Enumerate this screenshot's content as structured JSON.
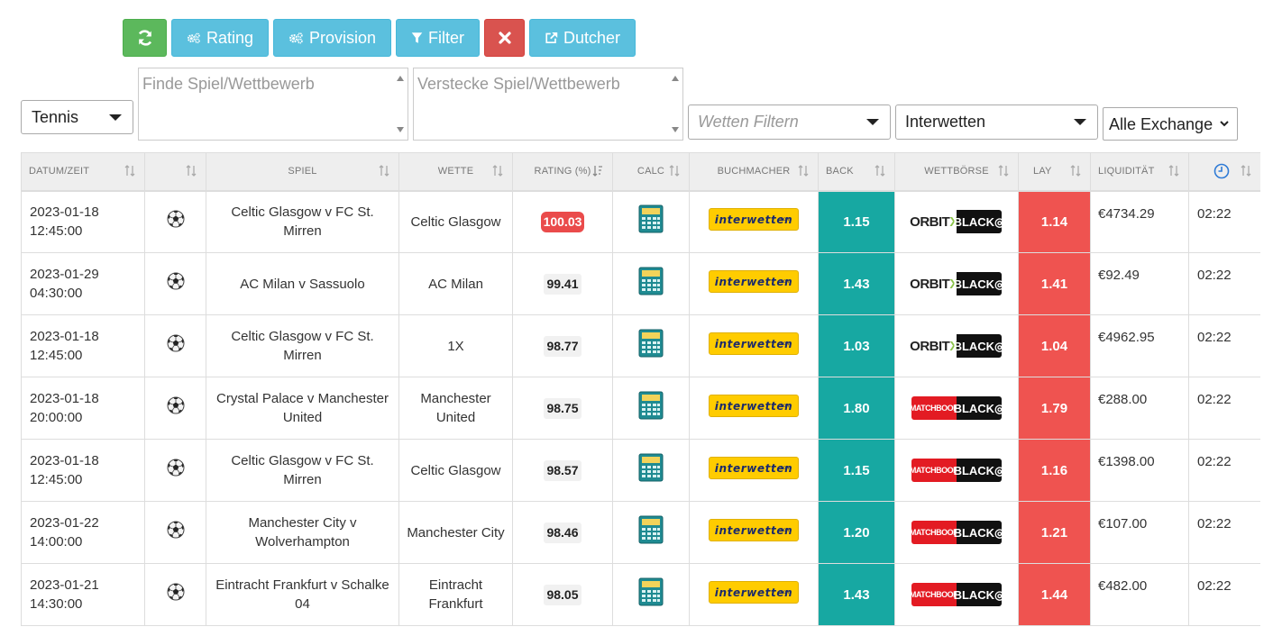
{
  "toolbar": {
    "rating_label": "Rating",
    "provision_label": "Provision",
    "filter_label": "Filter",
    "dutcher_label": "Dutcher"
  },
  "filters": {
    "sport": "Tennis",
    "find_placeholder": "Finde Spiel/Wettbewerb",
    "hide_placeholder": "Verstecke Spiel/Wettbewerb",
    "bets_placeholder": "Wetten Filtern",
    "bookmaker": "Interwetten",
    "exchange": "Alle Exchange"
  },
  "colors": {
    "refresh": "#5cb85c",
    "info": "#5bc0de",
    "danger": "#d9534f",
    "back": "#17a8a2",
    "lay": "#ef5350"
  },
  "table": {
    "headers": {
      "datetime": "DATUM/ZEIT",
      "match": "SPIEL",
      "bet": "WETTE",
      "rating": "RATING (%)",
      "calc": "CALC",
      "bookmaker": "BUCHMACHER",
      "back": "BACK",
      "exchange": "WETTBÖRSE",
      "lay": "LAY",
      "liquidity": "LIQUIDITÄT"
    },
    "rows": [
      {
        "date": "2023-01-18",
        "time": "12:45:00",
        "sport_icon": "soccer-ball-icon",
        "match": "Celtic Glasgow v FC St. Mirren",
        "bet": "Celtic Glasgow",
        "rating": "100.03",
        "highlight": true,
        "bookmaker": "interwetten",
        "back": "1.15",
        "exchange": "orbitx",
        "lay": "1.14",
        "liquidity": "€4734.29",
        "updated": "02:22"
      },
      {
        "date": "2023-01-29",
        "time": "04:30:00",
        "sport_icon": "soccer-ball-icon",
        "match": "AC Milan v Sassuolo",
        "bet": "AC Milan",
        "rating": "99.41",
        "highlight": false,
        "bookmaker": "interwetten",
        "back": "1.43",
        "exchange": "orbitx",
        "lay": "1.41",
        "liquidity": "€92.49",
        "updated": "02:22"
      },
      {
        "date": "2023-01-18",
        "time": "12:45:00",
        "sport_icon": "soccer-ball-icon",
        "match": "Celtic Glasgow v FC St. Mirren",
        "bet": "1X",
        "rating": "98.77",
        "highlight": false,
        "bookmaker": "interwetten",
        "back": "1.03",
        "exchange": "orbitx",
        "lay": "1.04",
        "liquidity": "€4962.95",
        "updated": "02:22"
      },
      {
        "date": "2023-01-18",
        "time": "20:00:00",
        "sport_icon": "soccer-ball-icon",
        "match": "Crystal Palace v Manchester United",
        "bet": "Manchester United",
        "rating": "98.75",
        "highlight": false,
        "bookmaker": "interwetten",
        "back": "1.80",
        "exchange": "matchbook",
        "lay": "1.79",
        "liquidity": "€288.00",
        "updated": "02:22"
      },
      {
        "date": "2023-01-18",
        "time": "12:45:00",
        "sport_icon": "soccer-ball-icon",
        "match": "Celtic Glasgow v FC St. Mirren",
        "bet": "Celtic Glasgow",
        "rating": "98.57",
        "highlight": false,
        "bookmaker": "interwetten",
        "back": "1.15",
        "exchange": "matchbook",
        "lay": "1.16",
        "liquidity": "€1398.00",
        "updated": "02:22"
      },
      {
        "date": "2023-01-22",
        "time": "14:00:00",
        "sport_icon": "soccer-ball-icon",
        "match": "Manchester City v Wolverhampton",
        "bet": "Manchester City",
        "rating": "98.46",
        "highlight": false,
        "bookmaker": "interwetten",
        "back": "1.20",
        "exchange": "matchbook",
        "lay": "1.21",
        "liquidity": "€107.00",
        "updated": "02:22"
      },
      {
        "date": "2023-01-21",
        "time": "14:30:00",
        "sport_icon": "soccer-ball-icon",
        "match": "Eintracht Frankfurt v Schalke 04",
        "bet": "Eintracht Frankfurt",
        "rating": "98.05",
        "highlight": false,
        "bookmaker": "interwetten",
        "back": "1.43",
        "exchange": "matchbook",
        "lay": "1.44",
        "liquidity": "€482.00",
        "updated": "02:22"
      }
    ]
  },
  "logos": {
    "interwetten": "interwetten",
    "interwetten_sub": ".com",
    "orbit": "ORBIT",
    "orbit_x": "X",
    "matchbook": "MATCHBOOK",
    "black": "BLACK"
  }
}
